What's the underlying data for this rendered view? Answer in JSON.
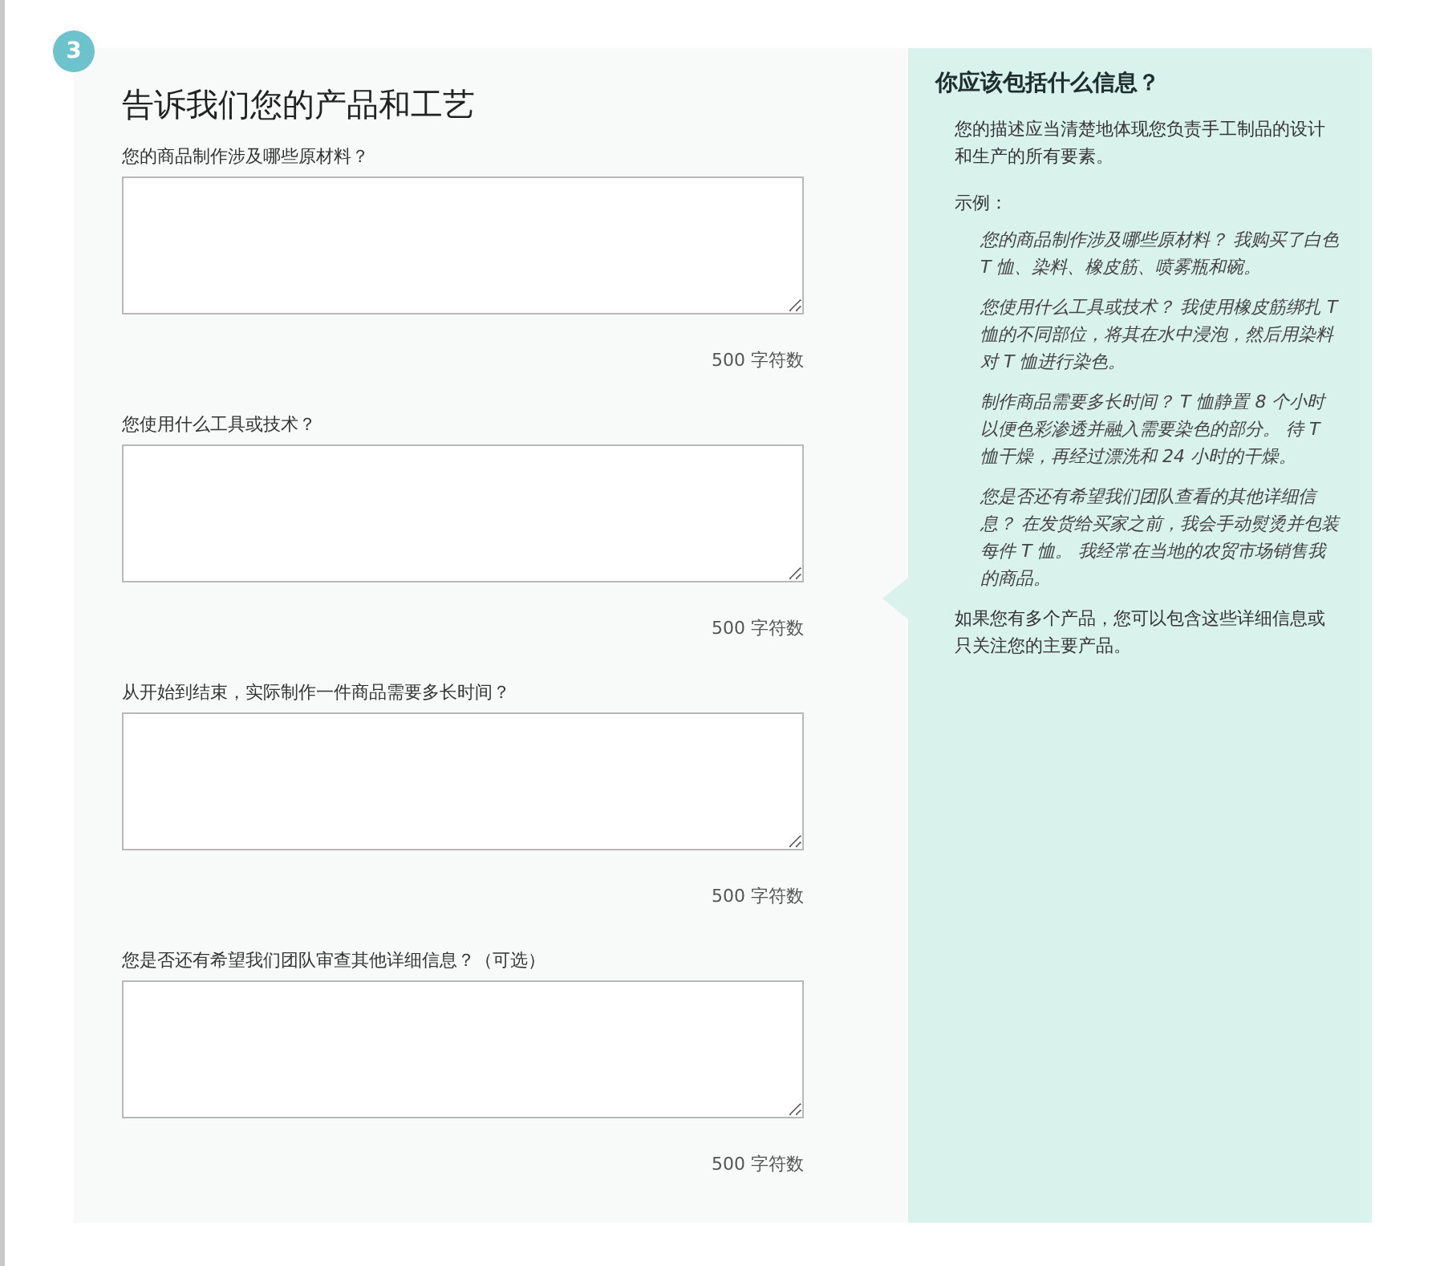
{
  "step": "3",
  "title": "告诉我们您的产品和工艺",
  "questions": [
    {
      "label": "您的商品制作涉及哪些原材料？",
      "counter": "500 字符数"
    },
    {
      "label": "您使用什么工具或技术？",
      "counter": "500 字符数"
    },
    {
      "label": "从开始到结束，实际制作一件商品需要多长时间？",
      "counter": "500 字符数"
    },
    {
      "label": "您是否还有希望我们团队审查其他详细信息？（可选）",
      "counter": "500 字符数"
    }
  ],
  "help": {
    "title": "你应该包括什么信息？",
    "intro": "您的描述应当清楚地体现您负责手工制品的设计和生产的所有要素。",
    "examples_label": "示例：",
    "examples": [
      "您的商品制作涉及哪些原材料？ 我购买了白色 T 恤、染料、橡皮筋、喷雾瓶和碗。",
      "您使用什么工具或技术？ 我使用橡皮筋绑扎 T 恤的不同部位，将其在水中浸泡，然后用染料对 T 恤进行染色。",
      "制作商品需要多长时间？ T 恤静置 8 个小时以便色彩渗透并融入需要染色的部分。 待 T 恤干燥，再经过漂洗和 24 小时的干燥。",
      "您是否还有希望我们团队查看的其他详细信息？ 在发货给买家之前，我会手动熨烫并包装每件 T 恤。 我经常在当地的农贸市场销售我的商品。"
    ],
    "footer": "如果您有多个产品，您可以包含这些详细信息或只关注您的主要产品。"
  }
}
